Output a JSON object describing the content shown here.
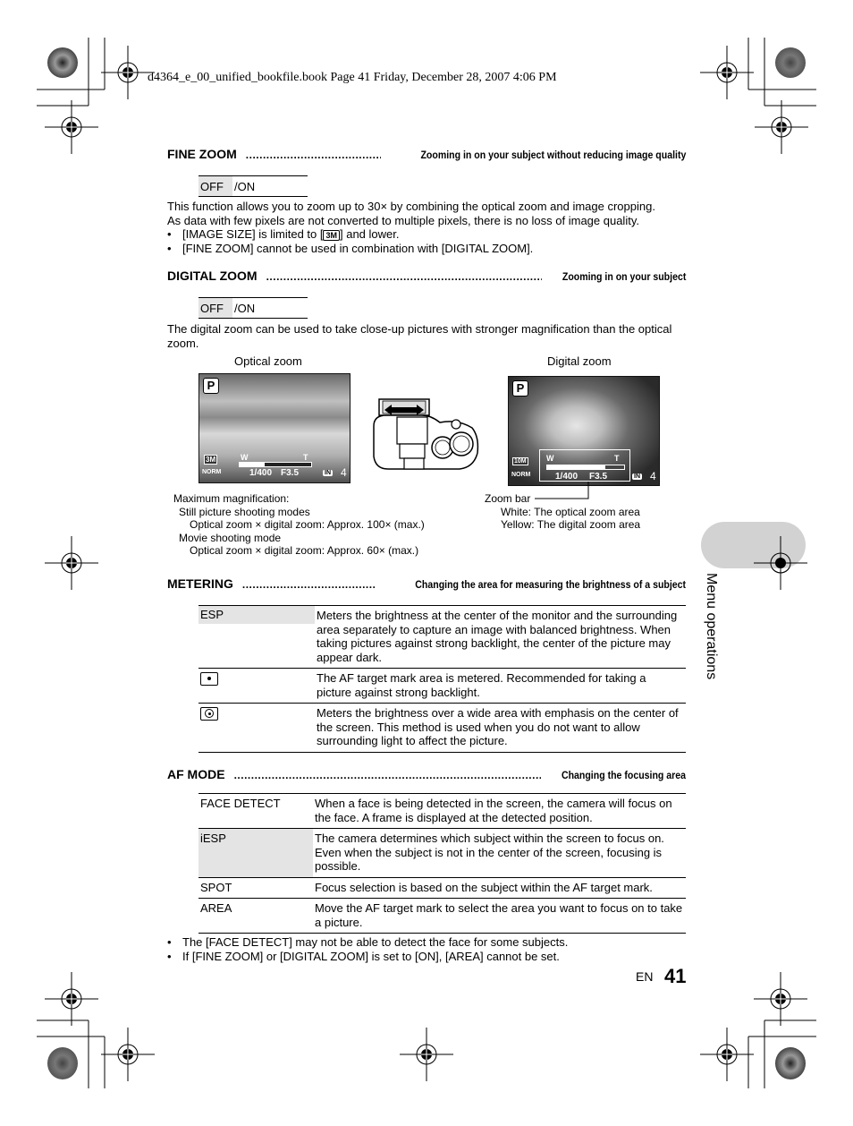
{
  "slug": "d4364_e_00_unified_bookfile.book  Page 41  Friday, December 28, 2007  4:06 PM",
  "fine_zoom": {
    "title": "FINE ZOOM",
    "dots": "................................................................................................",
    "subtitle": "Zooming in on your subject without reducing image quality",
    "options": {
      "selected": "OFF",
      "other": "/ON"
    },
    "body": [
      "This function allows you to zoom up to 30× by combining the optical zoom and image cropping.",
      "As data with few pixels are not converted to multiple pixels, there is no loss of image quality."
    ],
    "bullets": [
      {
        "before": "[IMAGE SIZE] is limited to [",
        "icon": "3M",
        "after": "] and lower."
      },
      {
        "text": "[FINE ZOOM] cannot be used in combination with [DIGITAL ZOOM]."
      }
    ]
  },
  "digital_zoom": {
    "title": "DIGITAL ZOOM",
    "dots": "................................................................................................................................",
    "subtitle": "Zooming in on your subject",
    "options": {
      "selected": "OFF",
      "other": "/ON"
    },
    "body": "The digital zoom can be used to take close-up pictures with stronger magnification than the optical zoom.",
    "optical_caption": "Optical zoom",
    "digital_caption": "Digital zoom",
    "screen_optical": {
      "mode": "P",
      "size": "3M",
      "quality": "NORM",
      "shutter": "1/400",
      "aperture": "F3.5",
      "mem": "IN",
      "count": "4",
      "w": "W",
      "t": "T",
      "zoom_fraction": 0.35
    },
    "screen_digital": {
      "mode": "P",
      "size": "10M",
      "quality": "NORM",
      "shutter": "1/400",
      "aperture": "F3.5",
      "mem": "IN",
      "count": "4",
      "w": "W",
      "t": "T",
      "zoom_fraction": 0.75
    },
    "max_mag": {
      "heading": "Maximum magnification:",
      "still_label": "Still picture shooting modes",
      "still_value": "Optical zoom × digital zoom: Approx. 100× (max.)",
      "movie_label": "Movie shooting mode",
      "movie_value": "Optical zoom × digital zoom: Approx. 60× (max.)"
    },
    "zoom_bar": {
      "label": "Zoom bar",
      "white": "White: The optical zoom area",
      "yellow": "Yellow: The digital zoom area"
    }
  },
  "metering": {
    "title": "METERING",
    "dots": "..........................................................................",
    "subtitle": "Changing the area for measuring the brightness of a subject",
    "rows": [
      {
        "key": "ESP",
        "icon": "",
        "desc": "Meters the brightness at the center of the monitor and the surrounding area separately to capture an image with balanced brightness. When taking pictures against strong backlight, the center of the picture may appear dark.",
        "shaded": true
      },
      {
        "key": "",
        "icon": "spot-metering-icon",
        "desc": "The AF target mark area is metered. Recommended for taking a picture against strong backlight.",
        "shaded": false
      },
      {
        "key": "",
        "icon": "center-weighted-icon",
        "desc": "Meters the brightness over a wide area with emphasis on the center of the screen. This method is used when you do not want to allow surrounding light to affect the picture.",
        "shaded": false
      }
    ]
  },
  "af_mode": {
    "title": "AF MODE",
    "dots": "..............................................................................................................................................",
    "subtitle": "Changing the focusing area",
    "rows": [
      {
        "key": "FACE DETECT",
        "desc": "When a face is being detected in the screen, the camera will focus on the face. A frame is displayed at the detected position.",
        "shaded": false
      },
      {
        "key": "iESP",
        "desc": "The camera determines which subject within the screen to focus on. Even when the subject is not in the center of the screen, focusing is possible.",
        "shaded": true
      },
      {
        "key": "SPOT",
        "desc": "Focus selection is based on the subject within the AF target mark.",
        "shaded": false
      },
      {
        "key": "AREA",
        "desc": "Move the AF target mark to select the area you want to focus on to take a picture.",
        "shaded": false
      }
    ],
    "notes": [
      "The [FACE DETECT] may not be able to detect the face for some subjects.",
      "If [FINE ZOOM] or [DIGITAL ZOOM] is set to [ON], [AREA] cannot be set."
    ]
  },
  "side_tab": "Menu operations",
  "page": {
    "lang": "EN",
    "number": "41"
  },
  "bullet_char": "•"
}
